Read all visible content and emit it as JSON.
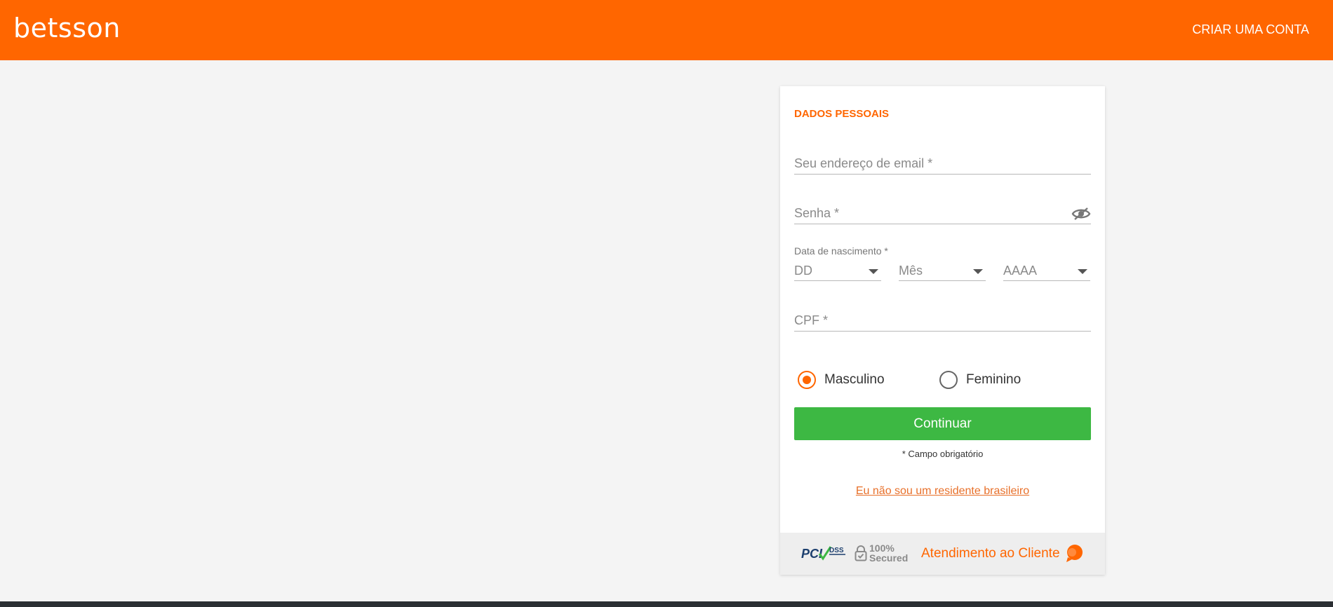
{
  "header": {
    "logo": "betsson",
    "create_account": "CRIAR UMA CONTA"
  },
  "form": {
    "title": "DADOS PESSOAIS",
    "email_placeholder": "Seu endereço de email *",
    "password_placeholder": "Senha *",
    "dob_label": "Data de nascimento *",
    "day_placeholder": "DD",
    "month_placeholder": "Mês",
    "year_placeholder": "AAAA",
    "cpf_placeholder": "CPF *",
    "gender_options": [
      "Masculino",
      "Feminino"
    ],
    "gender_selected": "Masculino",
    "continue_label": "Continuar",
    "required_note": "* Campo obrigatório",
    "not_resident_link": "Eu não sou um residente brasileiro"
  },
  "card_footer": {
    "pci_text": "PCI",
    "dss_text": "DSS",
    "secured_line1": "100%",
    "secured_line2": "Secured",
    "support_label": "Atendimento ao Cliente"
  },
  "colors": {
    "brand": "#ff6600",
    "button": "#3db843",
    "background": "#f4f4f4"
  },
  "icons": [
    "eye-slash-icon",
    "chevron-down-icon",
    "lock-icon",
    "chat-bubble-icon"
  ]
}
